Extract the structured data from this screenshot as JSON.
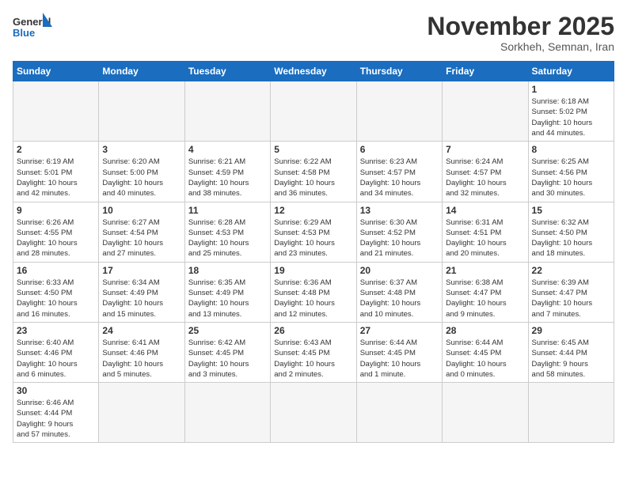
{
  "header": {
    "logo_general": "General",
    "logo_blue": "Blue",
    "month_title": "November 2025",
    "subtitle": "Sorkheh, Semnan, Iran"
  },
  "weekdays": [
    "Sunday",
    "Monday",
    "Tuesday",
    "Wednesday",
    "Thursday",
    "Friday",
    "Saturday"
  ],
  "weeks": [
    [
      {
        "day": "",
        "info": ""
      },
      {
        "day": "",
        "info": ""
      },
      {
        "day": "",
        "info": ""
      },
      {
        "day": "",
        "info": ""
      },
      {
        "day": "",
        "info": ""
      },
      {
        "day": "",
        "info": ""
      },
      {
        "day": "1",
        "info": "Sunrise: 6:18 AM\nSunset: 5:02 PM\nDaylight: 10 hours\nand 44 minutes."
      }
    ],
    [
      {
        "day": "2",
        "info": "Sunrise: 6:19 AM\nSunset: 5:01 PM\nDaylight: 10 hours\nand 42 minutes."
      },
      {
        "day": "3",
        "info": "Sunrise: 6:20 AM\nSunset: 5:00 PM\nDaylight: 10 hours\nand 40 minutes."
      },
      {
        "day": "4",
        "info": "Sunrise: 6:21 AM\nSunset: 4:59 PM\nDaylight: 10 hours\nand 38 minutes."
      },
      {
        "day": "5",
        "info": "Sunrise: 6:22 AM\nSunset: 4:58 PM\nDaylight: 10 hours\nand 36 minutes."
      },
      {
        "day": "6",
        "info": "Sunrise: 6:23 AM\nSunset: 4:57 PM\nDaylight: 10 hours\nand 34 minutes."
      },
      {
        "day": "7",
        "info": "Sunrise: 6:24 AM\nSunset: 4:57 PM\nDaylight: 10 hours\nand 32 minutes."
      },
      {
        "day": "8",
        "info": "Sunrise: 6:25 AM\nSunset: 4:56 PM\nDaylight: 10 hours\nand 30 minutes."
      }
    ],
    [
      {
        "day": "9",
        "info": "Sunrise: 6:26 AM\nSunset: 4:55 PM\nDaylight: 10 hours\nand 28 minutes."
      },
      {
        "day": "10",
        "info": "Sunrise: 6:27 AM\nSunset: 4:54 PM\nDaylight: 10 hours\nand 27 minutes."
      },
      {
        "day": "11",
        "info": "Sunrise: 6:28 AM\nSunset: 4:53 PM\nDaylight: 10 hours\nand 25 minutes."
      },
      {
        "day": "12",
        "info": "Sunrise: 6:29 AM\nSunset: 4:53 PM\nDaylight: 10 hours\nand 23 minutes."
      },
      {
        "day": "13",
        "info": "Sunrise: 6:30 AM\nSunset: 4:52 PM\nDaylight: 10 hours\nand 21 minutes."
      },
      {
        "day": "14",
        "info": "Sunrise: 6:31 AM\nSunset: 4:51 PM\nDaylight: 10 hours\nand 20 minutes."
      },
      {
        "day": "15",
        "info": "Sunrise: 6:32 AM\nSunset: 4:50 PM\nDaylight: 10 hours\nand 18 minutes."
      }
    ],
    [
      {
        "day": "16",
        "info": "Sunrise: 6:33 AM\nSunset: 4:50 PM\nDaylight: 10 hours\nand 16 minutes."
      },
      {
        "day": "17",
        "info": "Sunrise: 6:34 AM\nSunset: 4:49 PM\nDaylight: 10 hours\nand 15 minutes."
      },
      {
        "day": "18",
        "info": "Sunrise: 6:35 AM\nSunset: 4:49 PM\nDaylight: 10 hours\nand 13 minutes."
      },
      {
        "day": "19",
        "info": "Sunrise: 6:36 AM\nSunset: 4:48 PM\nDaylight: 10 hours\nand 12 minutes."
      },
      {
        "day": "20",
        "info": "Sunrise: 6:37 AM\nSunset: 4:48 PM\nDaylight: 10 hours\nand 10 minutes."
      },
      {
        "day": "21",
        "info": "Sunrise: 6:38 AM\nSunset: 4:47 PM\nDaylight: 10 hours\nand 9 minutes."
      },
      {
        "day": "22",
        "info": "Sunrise: 6:39 AM\nSunset: 4:47 PM\nDaylight: 10 hours\nand 7 minutes."
      }
    ],
    [
      {
        "day": "23",
        "info": "Sunrise: 6:40 AM\nSunset: 4:46 PM\nDaylight: 10 hours\nand 6 minutes."
      },
      {
        "day": "24",
        "info": "Sunrise: 6:41 AM\nSunset: 4:46 PM\nDaylight: 10 hours\nand 5 minutes."
      },
      {
        "day": "25",
        "info": "Sunrise: 6:42 AM\nSunset: 4:45 PM\nDaylight: 10 hours\nand 3 minutes."
      },
      {
        "day": "26",
        "info": "Sunrise: 6:43 AM\nSunset: 4:45 PM\nDaylight: 10 hours\nand 2 minutes."
      },
      {
        "day": "27",
        "info": "Sunrise: 6:44 AM\nSunset: 4:45 PM\nDaylight: 10 hours\nand 1 minute."
      },
      {
        "day": "28",
        "info": "Sunrise: 6:44 AM\nSunset: 4:45 PM\nDaylight: 10 hours\nand 0 minutes."
      },
      {
        "day": "29",
        "info": "Sunrise: 6:45 AM\nSunset: 4:44 PM\nDaylight: 9 hours\nand 58 minutes."
      }
    ],
    [
      {
        "day": "30",
        "info": "Sunrise: 6:46 AM\nSunset: 4:44 PM\nDaylight: 9 hours\nand 57 minutes."
      },
      {
        "day": "",
        "info": ""
      },
      {
        "day": "",
        "info": ""
      },
      {
        "day": "",
        "info": ""
      },
      {
        "day": "",
        "info": ""
      },
      {
        "day": "",
        "info": ""
      },
      {
        "day": "",
        "info": ""
      }
    ]
  ]
}
